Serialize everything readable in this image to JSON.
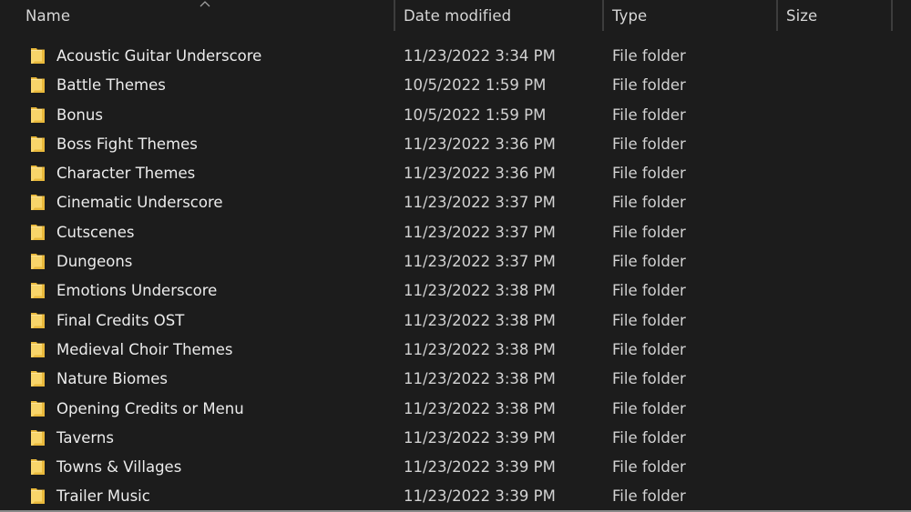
{
  "header": {
    "columns": {
      "name": "Name",
      "date": "Date modified",
      "type": "Type",
      "size": "Size"
    },
    "sort_icon": "chevron-up-icon",
    "sorted_by": "Name"
  },
  "colors": {
    "background": "#1c1c1c",
    "folder_main": "#f5c94a",
    "folder_light": "#fde08a",
    "text": "#ececec"
  },
  "files": [
    {
      "name": "Acoustic Guitar Underscore",
      "date": "11/23/2022 3:34 PM",
      "type": "File folder",
      "size": ""
    },
    {
      "name": "Battle Themes",
      "date": "10/5/2022 1:59 PM",
      "type": "File folder",
      "size": ""
    },
    {
      "name": "Bonus",
      "date": "10/5/2022 1:59 PM",
      "type": "File folder",
      "size": ""
    },
    {
      "name": "Boss Fight Themes",
      "date": "11/23/2022 3:36 PM",
      "type": "File folder",
      "size": ""
    },
    {
      "name": "Character Themes",
      "date": "11/23/2022 3:36 PM",
      "type": "File folder",
      "size": ""
    },
    {
      "name": "Cinematic Underscore",
      "date": "11/23/2022 3:37 PM",
      "type": "File folder",
      "size": ""
    },
    {
      "name": "Cutscenes",
      "date": "11/23/2022 3:37 PM",
      "type": "File folder",
      "size": ""
    },
    {
      "name": "Dungeons",
      "date": "11/23/2022 3:37 PM",
      "type": "File folder",
      "size": ""
    },
    {
      "name": "Emotions Underscore",
      "date": "11/23/2022 3:38 PM",
      "type": "File folder",
      "size": ""
    },
    {
      "name": "Final Credits OST",
      "date": "11/23/2022 3:38 PM",
      "type": "File folder",
      "size": ""
    },
    {
      "name": "Medieval Choir Themes",
      "date": "11/23/2022 3:38 PM",
      "type": "File folder",
      "size": ""
    },
    {
      "name": "Nature Biomes",
      "date": "11/23/2022 3:38 PM",
      "type": "File folder",
      "size": ""
    },
    {
      "name": "Opening Credits or Menu",
      "date": "11/23/2022 3:38 PM",
      "type": "File folder",
      "size": ""
    },
    {
      "name": "Taverns",
      "date": "11/23/2022 3:39 PM",
      "type": "File folder",
      "size": ""
    },
    {
      "name": "Towns & Villages",
      "date": "11/23/2022 3:39 PM",
      "type": "File folder",
      "size": ""
    },
    {
      "name": "Trailer Music",
      "date": "11/23/2022 3:39 PM",
      "type": "File folder",
      "size": ""
    }
  ]
}
